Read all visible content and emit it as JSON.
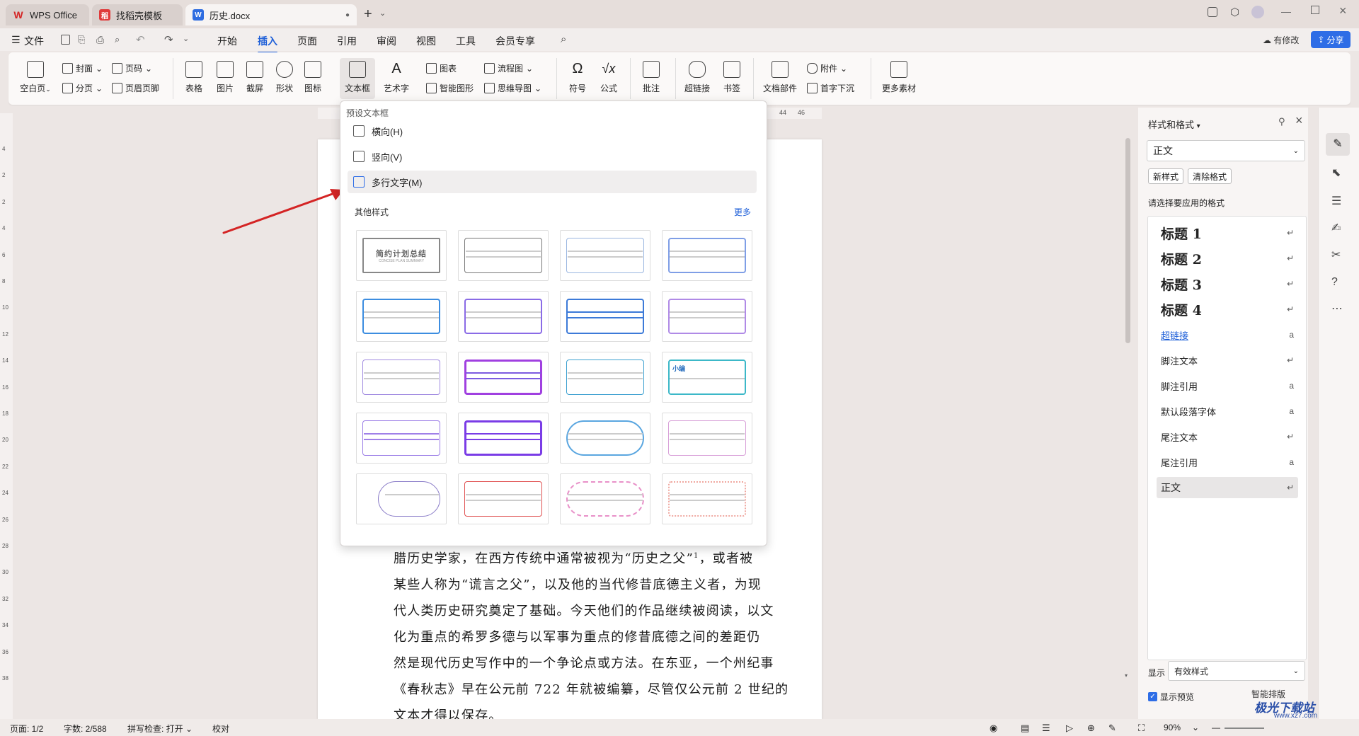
{
  "tabs": [
    {
      "label": "WPS Office"
    },
    {
      "label": "找稻壳模板"
    },
    {
      "label": "历史.docx"
    }
  ],
  "menubar": {
    "file_label": "文件",
    "items": [
      "开始",
      "插入",
      "页面",
      "引用",
      "审阅",
      "视图",
      "工具",
      "会员专享"
    ],
    "active": "插入",
    "revision_label": "有修改",
    "share_label": "分享"
  },
  "ribbon": {
    "blank_page": "空白页",
    "cover": "封面",
    "page_break": "分页",
    "page_num": "页码",
    "header_footer": "页眉页脚",
    "table": "表格",
    "picture": "图片",
    "screenshot": "截屏",
    "shape": "形状",
    "icon": "图标",
    "textbox": "文本框",
    "wordart": "艺术字",
    "chart": "图表",
    "smartart": "智能图形",
    "flowchart": "流程图",
    "mindmap": "思维导图",
    "symbol": "符号",
    "formula": "公式",
    "comment": "批注",
    "hyperlink": "超链接",
    "bookmark": "书签",
    "doc_parts": "文档部件",
    "attachment": "附件",
    "dropcap": "首字下沉",
    "more_material": "更多素材"
  },
  "dropdown": {
    "preset_title": "预设文本框",
    "horizontal": "横向(H)",
    "vertical": "竖向(V)",
    "multiline": "多行文字(M)",
    "other_title": "其他样式",
    "more": "更多",
    "tpl1_text": "简约计划总结",
    "tpl1_sub": "CONCISE PLAN SUMMARY",
    "tpl_small": "小编"
  },
  "ruler_top": [
    "44",
    "46"
  ],
  "ruler_left": [
    "4",
    "2",
    "2",
    "4",
    "6",
    "8",
    "10",
    "12",
    "14",
    "16",
    "18",
    "20",
    "22",
    "24",
    "26",
    "28",
    "30",
    "32",
    "34",
    "36",
    "38"
  ],
  "document": {
    "lines": [
      "腊历史学家，在西方传统中通常被视为“历史之父”",
      "某些人称为“谎言之父”，以及他的当代修昔底德主义者，为现",
      "代人类历史研究奠定了基础。今天他们的作品继续被阅读，以文",
      "化为重点的希罗多德与以军事为重点的修昔底德之间的差距仍",
      "然是现代历史写作中的一个争论点或方法。在东亚，一个州纪事",
      "《春秋志》早在公元前 722 年就被编纂，尽管仅公元前 2 世纪的",
      "文本才得以保存。"
    ],
    "line1_tail": "，或者被",
    "footnote_mark": "1"
  },
  "right_panel": {
    "title": "样式和格式",
    "current_style": "正文",
    "new_style": "新样式",
    "clear_format": "清除格式",
    "prompt": "请选择要应用的格式",
    "styles": [
      {
        "name": "标题  1",
        "kind": "h"
      },
      {
        "name": "标题  2",
        "kind": "h"
      },
      {
        "name": "标题  3",
        "kind": "h"
      },
      {
        "name": "标题  4",
        "kind": "h"
      },
      {
        "name": "超链接",
        "kind": "link"
      },
      {
        "name": "脚注文本",
        "kind": "n"
      },
      {
        "name": "脚注引用",
        "kind": "n"
      },
      {
        "name": "默认段落字体",
        "kind": "n"
      },
      {
        "name": "尾注文本",
        "kind": "n"
      },
      {
        "name": "尾注引用",
        "kind": "n"
      },
      {
        "name": "正文",
        "kind": "sel"
      }
    ],
    "show_label": "显示",
    "show_value": "有效样式",
    "preview_label": "显示预览",
    "smart_sort": "智能排版"
  },
  "status": {
    "page": "页面: 1/2",
    "words": "字数: 2/588",
    "spell": "拼写检查: 打开",
    "proof": "校对",
    "zoom": "90%"
  },
  "watermark": "极光下载站",
  "watermark_url": "www.xz7.com",
  "colors": {
    "accent": "#1e5fd8",
    "arrow": "#d42424"
  }
}
